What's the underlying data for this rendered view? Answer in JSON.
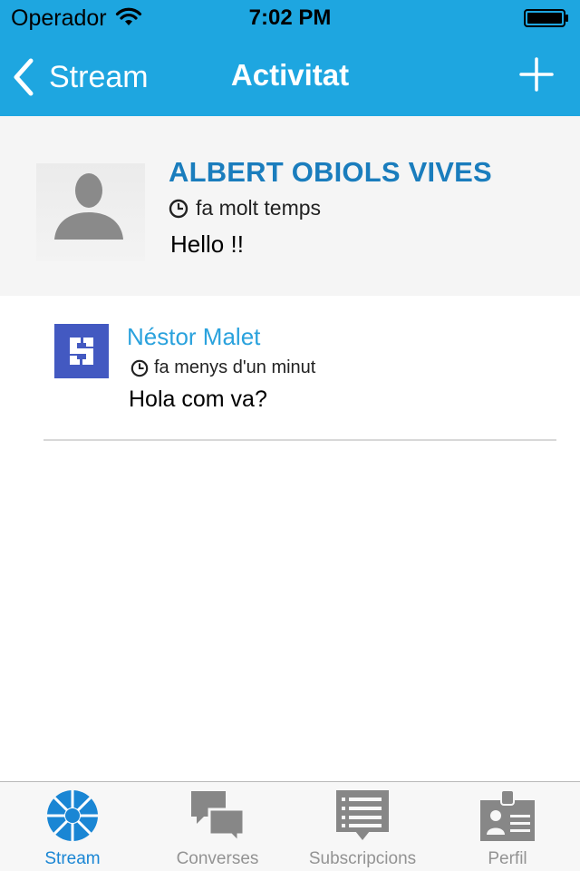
{
  "status_bar": {
    "carrier": "Operador",
    "time": "7:02 PM"
  },
  "nav": {
    "back_label": "Stream",
    "title": "Activitat",
    "add_icon": "plus-icon"
  },
  "main_post": {
    "author": "ALBERT OBIOLS VIVES",
    "time": "fa molt temps",
    "body": "Hello !!",
    "avatar_icon": "default-user-silhouette-icon"
  },
  "replies": [
    {
      "author": "Néstor Malet",
      "time": "fa menys d'un minut",
      "body": "Hola com va?",
      "avatar_icon": "s-logo-icon"
    }
  ],
  "tabbar": {
    "items": [
      {
        "label": "Stream",
        "icon": "stream-wheel-icon",
        "active": true
      },
      {
        "label": "Converses",
        "icon": "chat-bubbles-icon",
        "active": false
      },
      {
        "label": "Subscripcions",
        "icon": "subscriptions-list-icon",
        "active": false
      },
      {
        "label": "Perfil",
        "icon": "profile-card-icon",
        "active": false
      }
    ]
  },
  "colors": {
    "nav_background": "#1ea6e0",
    "main_author": "#1a7dbd",
    "reply_author": "#2aa2dd",
    "reply_avatar": "#4359c1",
    "tab_active": "#1a86d4",
    "tab_inactive": "#939393"
  }
}
